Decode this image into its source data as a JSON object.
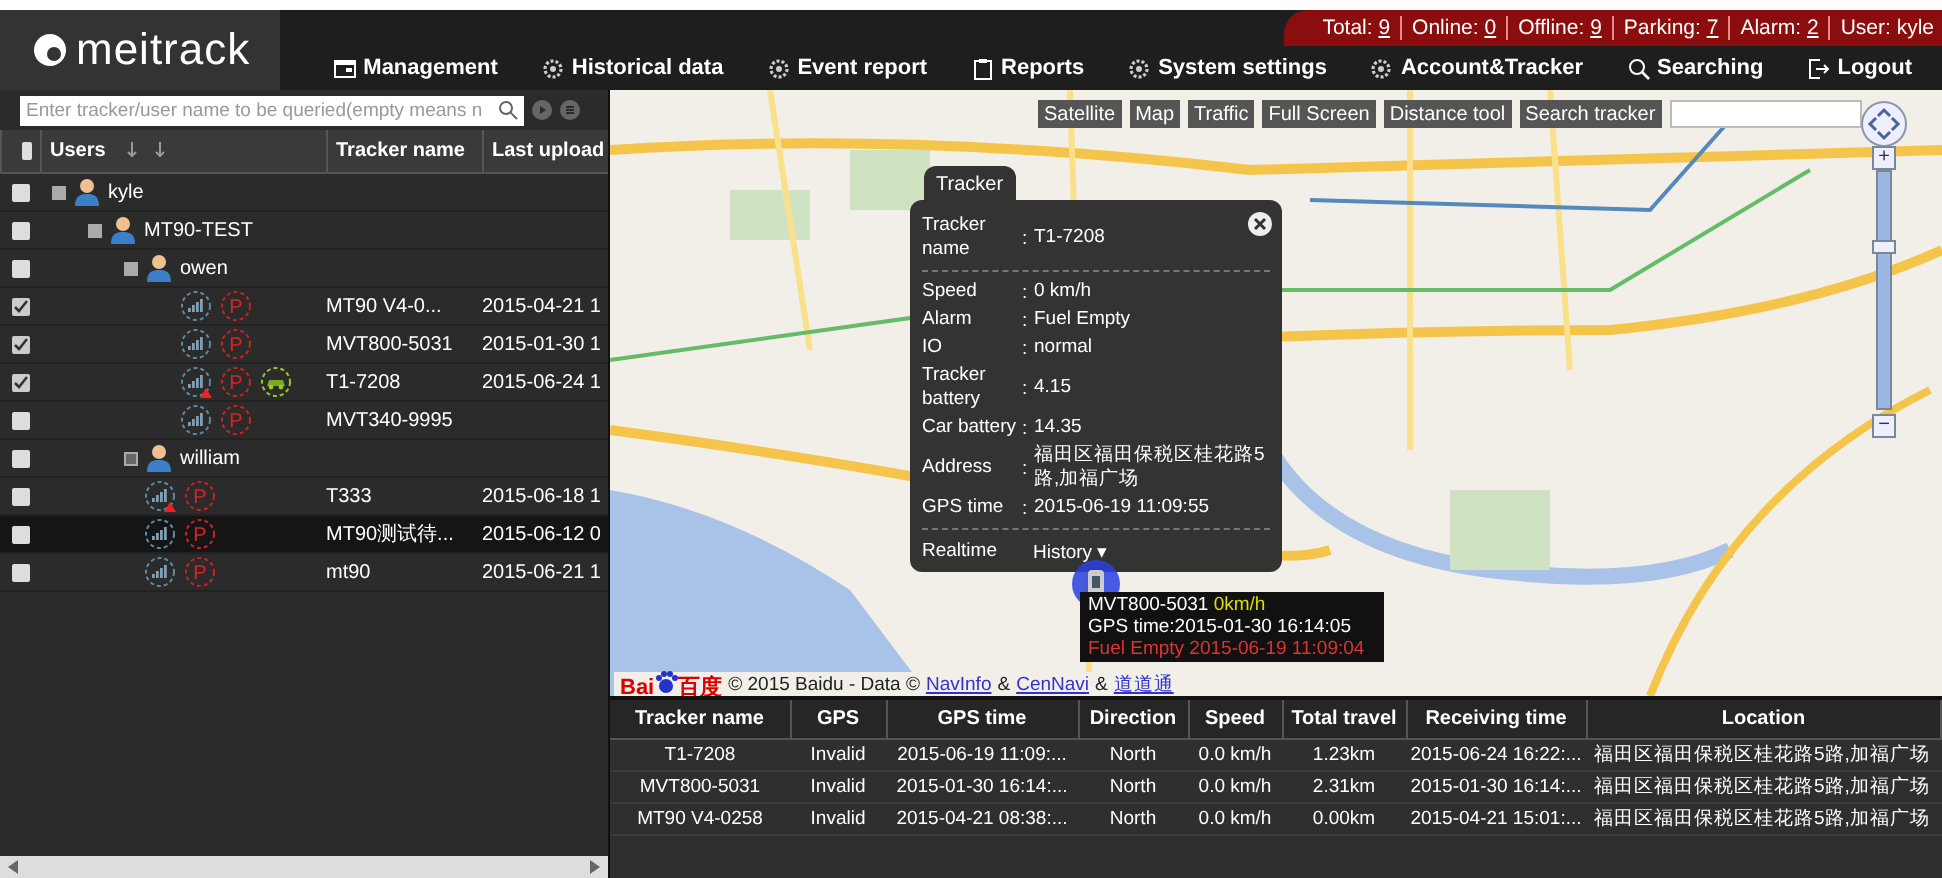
{
  "header": {
    "logo": "meitrack",
    "stats": [
      {
        "label": "Total:",
        "value": "9"
      },
      {
        "label": "Online:",
        "value": "0"
      },
      {
        "label": "Offline:",
        "value": "9"
      },
      {
        "label": "Parking:",
        "value": "7"
      },
      {
        "label": "Alarm:",
        "value": "2"
      }
    ],
    "user": "User: kyle",
    "nav": [
      {
        "label": "Management",
        "kind": "window"
      },
      {
        "label": "Historical data",
        "kind": "gear"
      },
      {
        "label": "Event report",
        "kind": "gear"
      },
      {
        "label": "Reports",
        "kind": "clipboard"
      },
      {
        "label": "System settings",
        "kind": "gear"
      },
      {
        "label": "Account&Tracker",
        "kind": "gear"
      },
      {
        "label": "Searching",
        "kind": "search"
      },
      {
        "label": "Logout",
        "kind": "exit"
      }
    ]
  },
  "sidebar": {
    "search": {
      "placeholder": "Enter tracker/user name to be queried(empty means n"
    },
    "select_all_checked": false,
    "columns": [
      "Users",
      "Tracker name",
      "Last upload"
    ],
    "tree": [
      {
        "kind": "user",
        "name": "kyle",
        "checked": false,
        "expanded": true,
        "selected": false,
        "children": [
          {
            "kind": "user",
            "name": "MT90-TEST",
            "checked": false,
            "expanded": true,
            "selected": false,
            "children": [
              {
                "kind": "user",
                "name": "owen",
                "checked": false,
                "expanded": true,
                "selected": false,
                "children": [
                  {
                    "kind": "tracker",
                    "tracker_name": "MT90 V4-0...",
                    "last_upload": "2015-04-21 1",
                    "parking": "P",
                    "checked": true,
                    "alarm": false,
                    "green_status": false,
                    "selected": false
                  },
                  {
                    "kind": "tracker",
                    "tracker_name": "MVT800-5031",
                    "last_upload": "2015-01-30 1",
                    "parking": "P",
                    "checked": true,
                    "alarm": false,
                    "green_status": false,
                    "selected": false
                  },
                  {
                    "kind": "tracker",
                    "tracker_name": "T1-7208",
                    "last_upload": "2015-06-24 1",
                    "parking": "P",
                    "checked": true,
                    "alarm": true,
                    "green_status": true,
                    "selected": false
                  },
                  {
                    "kind": "tracker",
                    "tracker_name": "MVT340-9995",
                    "parking": "P",
                    "checked": false,
                    "alarm": false,
                    "green_status": false,
                    "selected": false
                  }
                ]
              },
              {
                "kind": "user",
                "name": "william",
                "checked": false,
                "expanded": false,
                "selected": false
              },
              {
                "kind": "tracker",
                "tracker_name": "T333",
                "last_upload": "2015-06-18 1",
                "parking": "P",
                "checked": false,
                "alarm": true,
                "green_status": false,
                "selected": false
              },
              {
                "kind": "tracker",
                "tracker_name": "MT90测试待...",
                "last_upload": "2015-06-12 0",
                "parking": "P",
                "checked": false,
                "alarm": false,
                "green_status": false,
                "selected": true
              },
              {
                "kind": "tracker",
                "tracker_name": "mt90",
                "last_upload": "2015-06-21 1",
                "parking": "P",
                "checked": false,
                "alarm": false,
                "green_status": false,
                "selected": false
              }
            ]
          }
        ]
      }
    ]
  },
  "map": {
    "toolbar": [
      "Satellite",
      "Map",
      "Traffic",
      "Full Screen",
      "Distance tool",
      "Search tracker"
    ],
    "zoom": {
      "level": 0.7,
      "in_label": "+",
      "out_label": "−"
    },
    "popup": {
      "tab": "Tracker",
      "separator": ":",
      "fields": [
        {
          "label": "Tracker name",
          "value": "T1-7208",
          "divider": true
        },
        {
          "label": "Speed",
          "value": "0 km/h",
          "divider": false
        },
        {
          "label": "Alarm",
          "value": "Fuel Empty",
          "divider": false
        },
        {
          "label": "IO",
          "value": "normal",
          "divider": false
        },
        {
          "label": "Tracker battery",
          "value": "4.15",
          "divider": false
        },
        {
          "label": "Car battery",
          "value": "14.35",
          "divider": false
        },
        {
          "label": "Address",
          "value": "福田区福田保税区桂花路5路,加福广场",
          "divider": false
        },
        {
          "label": "GPS time",
          "value": "2015-06-19 11:09:55",
          "divider": true
        }
      ],
      "links": [
        "Realtime",
        "History ▾"
      ]
    },
    "marker_label": {
      "name": "MVT800-5031",
      "speed": "0km/h",
      "gps_time": "GPS time:2015-01-30 16:14:05",
      "alarm": "Fuel Empty 2015-06-19 11:09:04"
    },
    "copyright": {
      "logo_left": "Bai",
      "logo_right": "百度",
      "text": "© 2015 Baidu - Data ©",
      "links": [
        "NavInfo",
        "CenNavi",
        "道道通"
      ],
      "separator": "&"
    }
  },
  "table": {
    "columns": [
      "Tracker name",
      "GPS",
      "GPS time",
      "Direction",
      "Speed",
      "Total travel",
      "Receiving time",
      "Location"
    ],
    "rows": [
      [
        "T1-7208",
        "Invalid",
        "2015-06-19 11:09:...",
        "North",
        "0.0 km/h",
        "1.23km",
        "2015-06-24 16:22:...",
        "福田区福田保税区桂花路5路,加福广场"
      ],
      [
        "MVT800-5031",
        "Invalid",
        "2015-01-30 16:14:...",
        "North",
        "0.0 km/h",
        "2.31km",
        "2015-01-30 16:14:...",
        "福田区福田保税区桂花路5路,加福广场"
      ],
      [
        "MT90 V4-0258",
        "Invalid",
        "2015-04-21 08:38:...",
        "North",
        "0.0 km/h",
        "0.00km",
        "2015-04-21 15:01:...",
        "福田区福田保税区桂花路5路,加福广场"
      ]
    ]
  }
}
